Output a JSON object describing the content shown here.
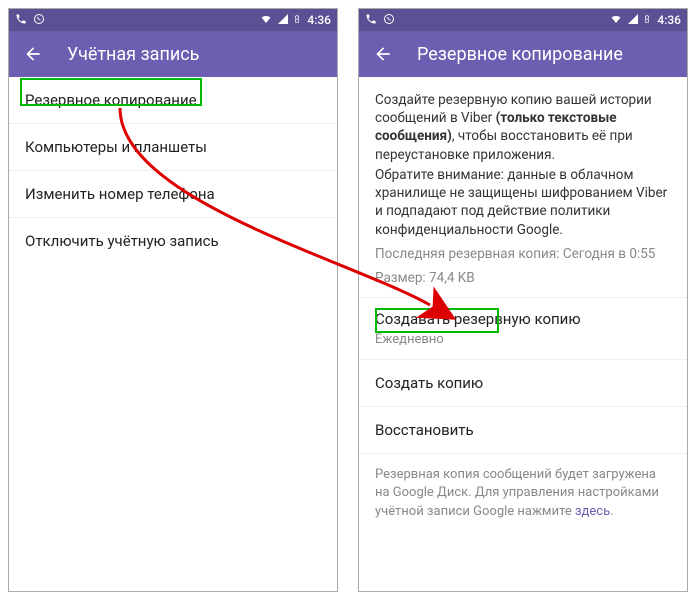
{
  "status": {
    "time": "4:36",
    "phone_icon": "phone",
    "viber_icon": "viber"
  },
  "left": {
    "title": "Учётная запись",
    "items": [
      "Резервное копирование",
      "Компьютеры и планшеты",
      "Изменить номер телефона",
      "Отключить учётную запись"
    ]
  },
  "right": {
    "title": "Резервное копирование",
    "info_pre": "Создайте резервную копию вашей истории сообщений в Viber ",
    "info_bold": "(только текстовые сообщения)",
    "info_post": ", чтобы восстановить её при переустановке приложения.",
    "info_warn": "Обратите внимание: данные в облачном хранилище не защищены шифрованием Viber и подпадают под действие политики конфиденциальности Google.",
    "last_backup": "Последняя резервная копия: Сегодня в 0:55",
    "size": "Размер: 74,4 KB",
    "schedule_title": "Создавать резервную копию",
    "schedule_value": "Ежедневно",
    "create_label": "Создать копию",
    "restore_label": "Восстановить",
    "footer_pre": "Резервная копия сообщений будет загружена на Google Диск. Для управления настройками учётной записи Google нажмите ",
    "footer_link": "здесь",
    "footer_post": "."
  }
}
